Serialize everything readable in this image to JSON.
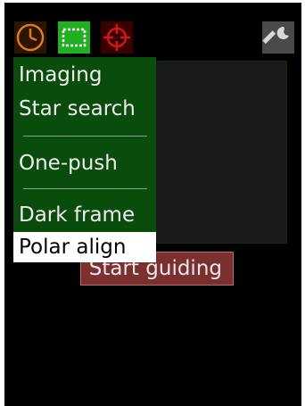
{
  "toolbar": {
    "icons": [
      "clock-icon",
      "frame-icon",
      "crosshair-icon",
      "wrench-icon"
    ],
    "colors": {
      "clock": "#e07820",
      "frame": "#ffffff",
      "crosshair": "#d01818",
      "wrench": "#d8d8d8"
    }
  },
  "menu": {
    "items": [
      {
        "label": "Imaging"
      },
      {
        "label": "Star search"
      },
      {
        "label": "One-push"
      },
      {
        "label": "Dark frame"
      },
      {
        "label": "Polar align",
        "selected": true
      }
    ]
  },
  "main": {
    "start_label": "Start guiding"
  },
  "colors": {
    "background": "#000000",
    "menu_bg": "#0a4c0c",
    "button_bg": "#7a302f"
  }
}
